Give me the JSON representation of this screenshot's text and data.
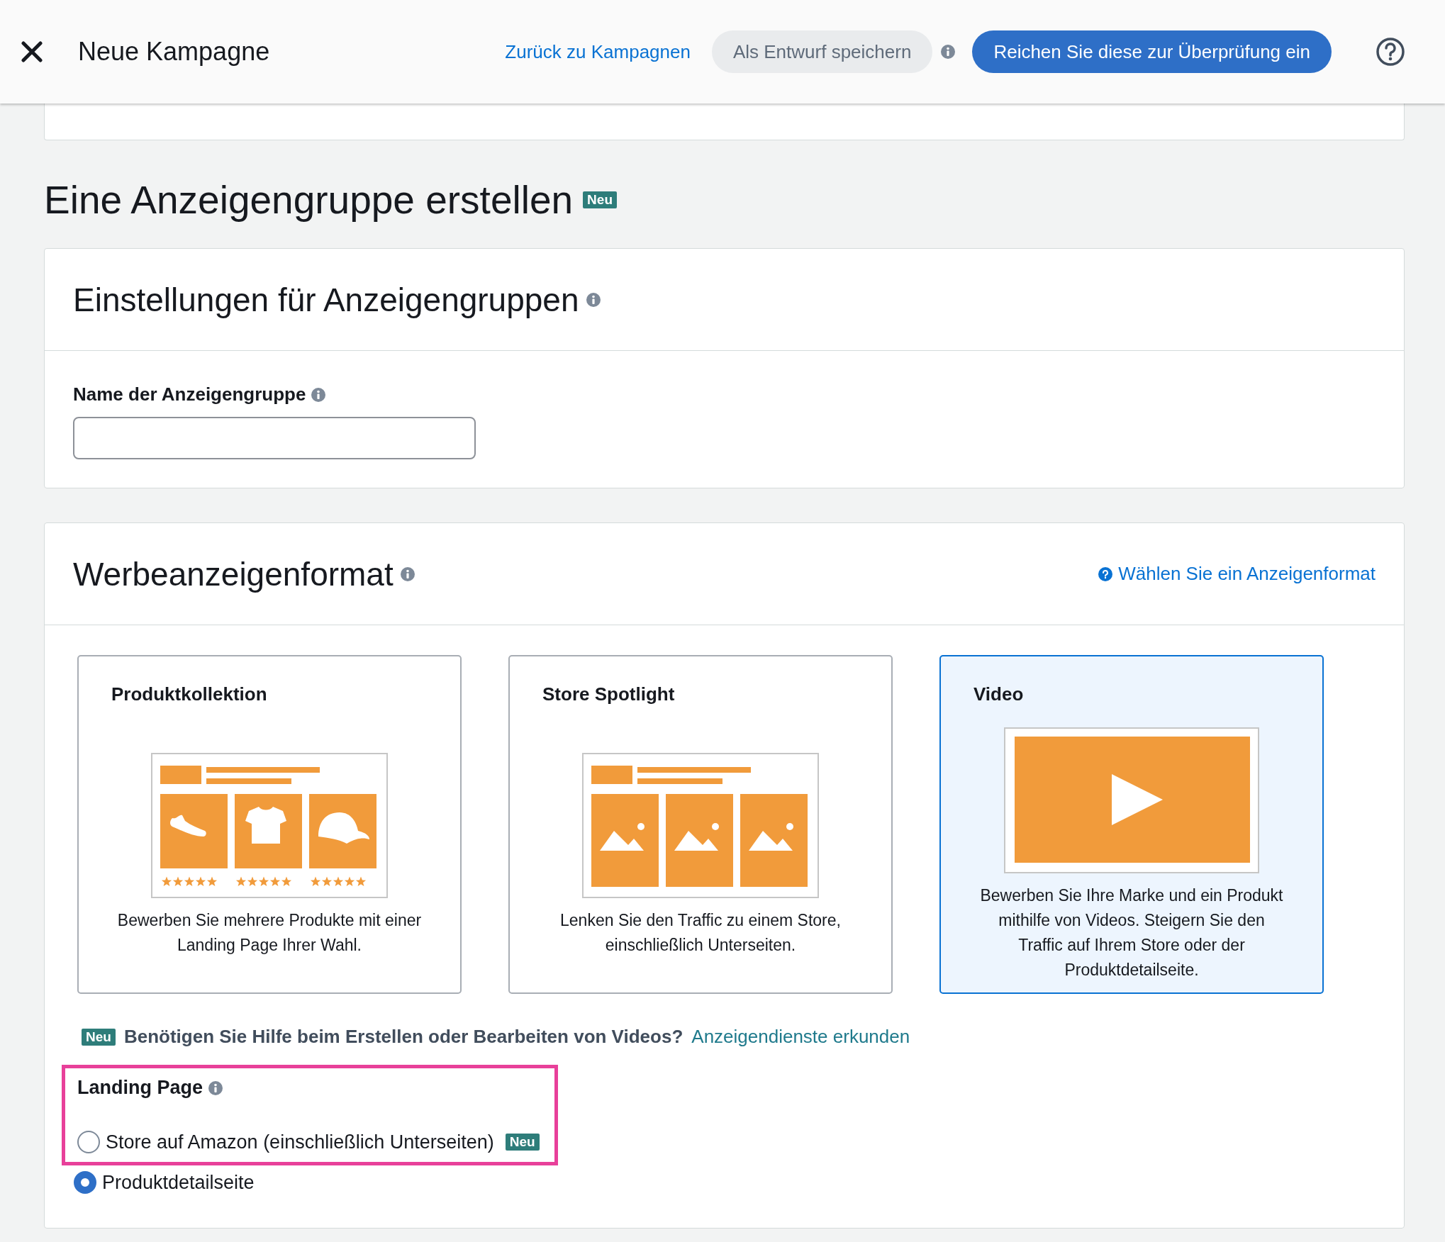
{
  "header": {
    "title": "Neue Kampagne",
    "back_link": "Zurück zu Kampagnen",
    "draft_button": "Als Entwurf speichern",
    "submit_button": "Reichen Sie diese zur Überprüfung ein"
  },
  "section": {
    "title": "Eine Anzeigengruppe erstellen",
    "badge": "Neu"
  },
  "settings_card": {
    "title": "Einstellungen für Anzeigengruppen",
    "name_field": {
      "label": "Name der Anzeigengruppe"
    }
  },
  "format_card": {
    "title": "Werbeanzeigenformat",
    "help_link": "Wählen Sie ein Anzeigenformat",
    "formats": [
      {
        "kind": "collection",
        "title": "Produktkollektion",
        "description": "Bewerben Sie mehrere Produkte mit einer Landing Page Ihrer Wahl.",
        "selected": false
      },
      {
        "kind": "spotlight",
        "title": "Store Spotlight",
        "description": "Lenken Sie den Traffic zu einem Store, einschließlich Unterseiten.",
        "selected": false
      },
      {
        "kind": "video",
        "title": "Video",
        "description": "Bewerben Sie Ihre Marke und ein Produkt mithilfe von Videos. Steigern Sie den Traffic auf Ihrem Store oder der Produktdetailseite.",
        "selected": true
      }
    ],
    "help_notice": {
      "badge": "Neu",
      "text": "Benötigen Sie Hilfe beim Erstellen oder Bearbeiten von Videos?",
      "link": "Anzeigendienste erkunden"
    },
    "landing_page": {
      "label": "Landing Page",
      "highlighted": true,
      "options": [
        {
          "label": "Store auf Amazon (einschließlich Unterseiten)",
          "badge": "Neu",
          "selected": false,
          "highlighted": true
        },
        {
          "label": "Produktdetailseite",
          "selected": true,
          "highlighted": false
        }
      ]
    }
  }
}
